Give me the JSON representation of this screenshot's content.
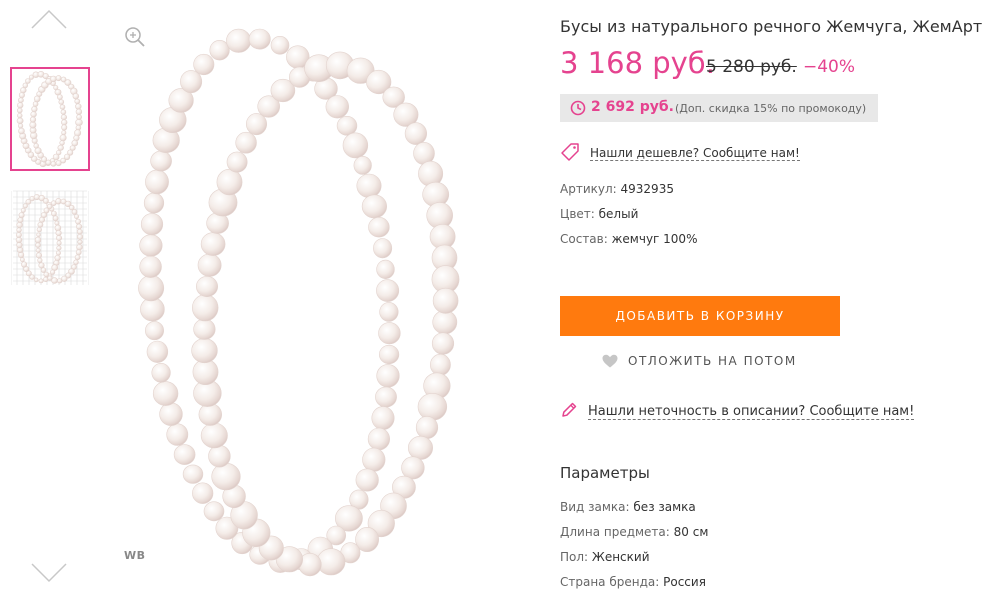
{
  "gallery": {
    "up_icon": "chevron-up-icon",
    "down_icon": "chevron-down-icon",
    "zoom_icon": "zoom-in-icon",
    "brand_mark": "WB",
    "accent_color": "#e5438f"
  },
  "product": {
    "title": "Бусы из натурального речного Жемчуга, ЖемАрт",
    "price": "3 168 руб.",
    "old_price": "5 280 руб.",
    "discount": "−40%",
    "promo_price": "2 692 руб.",
    "promo_note": "(Доп. скидка 15% по промокоду)",
    "cheaper_link": "Нашли дешевле? Сообщите нам!",
    "details": [
      {
        "key": "Артикул:",
        "value": "4932935"
      },
      {
        "key": "Цвет:",
        "value": "белый"
      },
      {
        "key": "Состав:",
        "value": "жемчуг 100%"
      }
    ],
    "add_to_cart": "ДОБАВИТЬ В КОРЗИНУ",
    "save_later": "ОТЛОЖИТЬ НА ПОТОМ",
    "inaccuracy_link": "Нашли неточность в описании? Сообщите нам!",
    "params_title": "Параметры",
    "params": [
      {
        "key": "Вид замка:",
        "value": "без замка"
      },
      {
        "key": "Длина предмета:",
        "value": "80 см"
      },
      {
        "key": "Пол:",
        "value": "Женский"
      },
      {
        "key": "Страна бренда:",
        "value": "Россия"
      }
    ],
    "cart_color": "#ff7a0e"
  }
}
